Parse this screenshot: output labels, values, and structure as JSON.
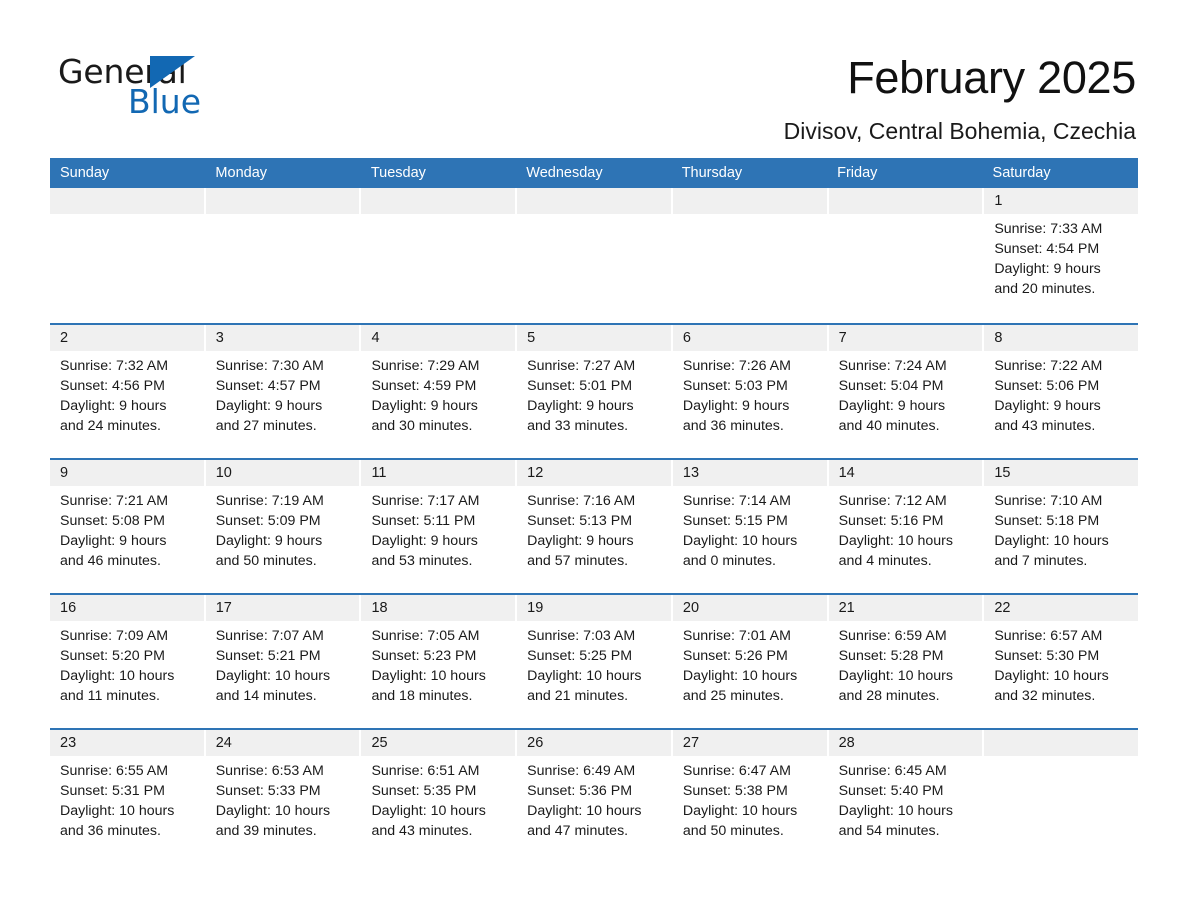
{
  "brand": {
    "name_part1": "General",
    "name_part2": "Blue",
    "triangle_color": "#1268B3",
    "blue_text_color": "#1268B3"
  },
  "header": {
    "month_title": "February 2025",
    "location": "Divisov, Central Bohemia, Czechia"
  },
  "theme": {
    "header_blue": "#2E74B5",
    "daynum_band_gray": "#F0F0F0",
    "text_color": "#1a1a1a",
    "page_background": "#ffffff"
  },
  "weekday_headers": [
    "Sunday",
    "Monday",
    "Tuesday",
    "Wednesday",
    "Thursday",
    "Friday",
    "Saturday"
  ],
  "weeks": [
    [
      {
        "day": "",
        "lines": []
      },
      {
        "day": "",
        "lines": []
      },
      {
        "day": "",
        "lines": []
      },
      {
        "day": "",
        "lines": []
      },
      {
        "day": "",
        "lines": []
      },
      {
        "day": "",
        "lines": []
      },
      {
        "day": "1",
        "lines": [
          "Sunrise: 7:33 AM",
          "Sunset: 4:54 PM",
          "Daylight: 9 hours",
          "and 20 minutes."
        ]
      }
    ],
    [
      {
        "day": "2",
        "lines": [
          "Sunrise: 7:32 AM",
          "Sunset: 4:56 PM",
          "Daylight: 9 hours",
          "and 24 minutes."
        ]
      },
      {
        "day": "3",
        "lines": [
          "Sunrise: 7:30 AM",
          "Sunset: 4:57 PM",
          "Daylight: 9 hours",
          "and 27 minutes."
        ]
      },
      {
        "day": "4",
        "lines": [
          "Sunrise: 7:29 AM",
          "Sunset: 4:59 PM",
          "Daylight: 9 hours",
          "and 30 minutes."
        ]
      },
      {
        "day": "5",
        "lines": [
          "Sunrise: 7:27 AM",
          "Sunset: 5:01 PM",
          "Daylight: 9 hours",
          "and 33 minutes."
        ]
      },
      {
        "day": "6",
        "lines": [
          "Sunrise: 7:26 AM",
          "Sunset: 5:03 PM",
          "Daylight: 9 hours",
          "and 36 minutes."
        ]
      },
      {
        "day": "7",
        "lines": [
          "Sunrise: 7:24 AM",
          "Sunset: 5:04 PM",
          "Daylight: 9 hours",
          "and 40 minutes."
        ]
      },
      {
        "day": "8",
        "lines": [
          "Sunrise: 7:22 AM",
          "Sunset: 5:06 PM",
          "Daylight: 9 hours",
          "and 43 minutes."
        ]
      }
    ],
    [
      {
        "day": "9",
        "lines": [
          "Sunrise: 7:21 AM",
          "Sunset: 5:08 PM",
          "Daylight: 9 hours",
          "and 46 minutes."
        ]
      },
      {
        "day": "10",
        "lines": [
          "Sunrise: 7:19 AM",
          "Sunset: 5:09 PM",
          "Daylight: 9 hours",
          "and 50 minutes."
        ]
      },
      {
        "day": "11",
        "lines": [
          "Sunrise: 7:17 AM",
          "Sunset: 5:11 PM",
          "Daylight: 9 hours",
          "and 53 minutes."
        ]
      },
      {
        "day": "12",
        "lines": [
          "Sunrise: 7:16 AM",
          "Sunset: 5:13 PM",
          "Daylight: 9 hours",
          "and 57 minutes."
        ]
      },
      {
        "day": "13",
        "lines": [
          "Sunrise: 7:14 AM",
          "Sunset: 5:15 PM",
          "Daylight: 10 hours",
          "and 0 minutes."
        ]
      },
      {
        "day": "14",
        "lines": [
          "Sunrise: 7:12 AM",
          "Sunset: 5:16 PM",
          "Daylight: 10 hours",
          "and 4 minutes."
        ]
      },
      {
        "day": "15",
        "lines": [
          "Sunrise: 7:10 AM",
          "Sunset: 5:18 PM",
          "Daylight: 10 hours",
          "and 7 minutes."
        ]
      }
    ],
    [
      {
        "day": "16",
        "lines": [
          "Sunrise: 7:09 AM",
          "Sunset: 5:20 PM",
          "Daylight: 10 hours",
          "and 11 minutes."
        ]
      },
      {
        "day": "17",
        "lines": [
          "Sunrise: 7:07 AM",
          "Sunset: 5:21 PM",
          "Daylight: 10 hours",
          "and 14 minutes."
        ]
      },
      {
        "day": "18",
        "lines": [
          "Sunrise: 7:05 AM",
          "Sunset: 5:23 PM",
          "Daylight: 10 hours",
          "and 18 minutes."
        ]
      },
      {
        "day": "19",
        "lines": [
          "Sunrise: 7:03 AM",
          "Sunset: 5:25 PM",
          "Daylight: 10 hours",
          "and 21 minutes."
        ]
      },
      {
        "day": "20",
        "lines": [
          "Sunrise: 7:01 AM",
          "Sunset: 5:26 PM",
          "Daylight: 10 hours",
          "and 25 minutes."
        ]
      },
      {
        "day": "21",
        "lines": [
          "Sunrise: 6:59 AM",
          "Sunset: 5:28 PM",
          "Daylight: 10 hours",
          "and 28 minutes."
        ]
      },
      {
        "day": "22",
        "lines": [
          "Sunrise: 6:57 AM",
          "Sunset: 5:30 PM",
          "Daylight: 10 hours",
          "and 32 minutes."
        ]
      }
    ],
    [
      {
        "day": "23",
        "lines": [
          "Sunrise: 6:55 AM",
          "Sunset: 5:31 PM",
          "Daylight: 10 hours",
          "and 36 minutes."
        ]
      },
      {
        "day": "24",
        "lines": [
          "Sunrise: 6:53 AM",
          "Sunset: 5:33 PM",
          "Daylight: 10 hours",
          "and 39 minutes."
        ]
      },
      {
        "day": "25",
        "lines": [
          "Sunrise: 6:51 AM",
          "Sunset: 5:35 PM",
          "Daylight: 10 hours",
          "and 43 minutes."
        ]
      },
      {
        "day": "26",
        "lines": [
          "Sunrise: 6:49 AM",
          "Sunset: 5:36 PM",
          "Daylight: 10 hours",
          "and 47 minutes."
        ]
      },
      {
        "day": "27",
        "lines": [
          "Sunrise: 6:47 AM",
          "Sunset: 5:38 PM",
          "Daylight: 10 hours",
          "and 50 minutes."
        ]
      },
      {
        "day": "28",
        "lines": [
          "Sunrise: 6:45 AM",
          "Sunset: 5:40 PM",
          "Daylight: 10 hours",
          "and 54 minutes."
        ]
      },
      {
        "day": "",
        "lines": []
      }
    ]
  ]
}
